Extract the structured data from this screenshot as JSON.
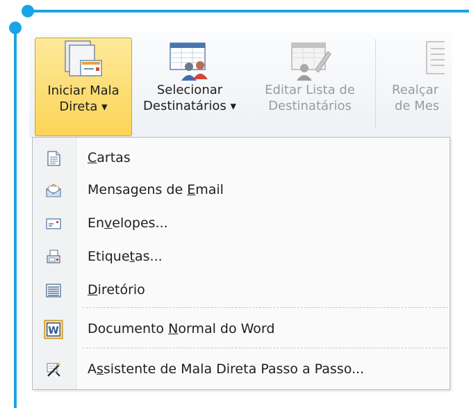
{
  "ribbon": {
    "buttons": [
      {
        "line1": "Iniciar Mala",
        "line2": "Direta",
        "has_caret": true,
        "state": "active",
        "icon": "start-mail-merge-icon"
      },
      {
        "line1": "Selecionar",
        "line2": "Destinatários",
        "has_caret": true,
        "state": "normal",
        "icon": "select-recipients-icon"
      },
      {
        "line1": "Editar Lista de",
        "line2": "Destinatários",
        "has_caret": false,
        "state": "disabled",
        "icon": "edit-recipient-list-icon"
      },
      {
        "line1": "Realçar",
        "line2": "de Mes",
        "has_caret": false,
        "state": "disabled",
        "icon": "highlight-merge-fields-icon"
      }
    ]
  },
  "menu": {
    "items": [
      {
        "pre": "",
        "key": "C",
        "post": "artas",
        "icon": "letters-icon"
      },
      {
        "pre": "Mensagens de ",
        "key": "E",
        "post": "mail",
        "icon": "email-messages-icon"
      },
      {
        "pre": "En",
        "key": "v",
        "post": "elopes...",
        "icon": "envelopes-icon"
      },
      {
        "pre": "Etique",
        "key": "t",
        "post": "as...",
        "icon": "labels-icon"
      },
      {
        "pre": "",
        "key": "D",
        "post": "iretório",
        "icon": "directory-icon"
      },
      {
        "pre": "Documento ",
        "key": "N",
        "post": "ormal do Word",
        "icon": "word-document-icon"
      },
      {
        "pre": "A",
        "key": "s",
        "post": "sistente de Mala Direta Passo a Passo...",
        "icon": "mail-merge-wizard-icon"
      }
    ]
  },
  "colors": {
    "frame_accent": "#1ba4e3",
    "active_button_fill": "#fcd456",
    "word_icon_blue": "#2b5797"
  }
}
